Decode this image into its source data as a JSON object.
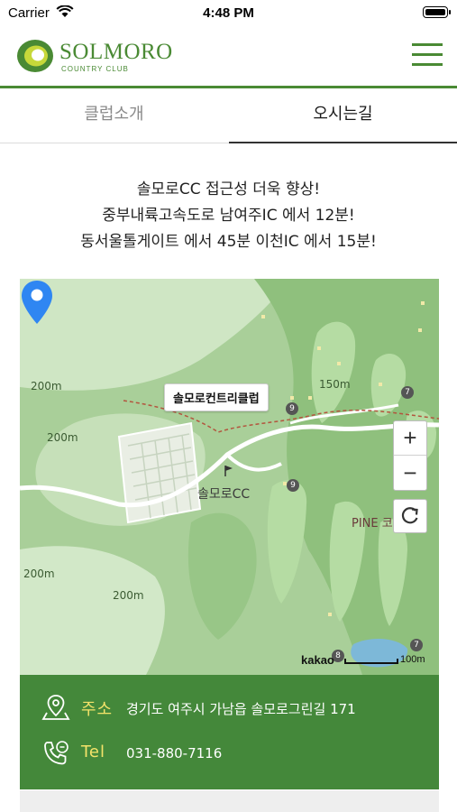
{
  "status_bar": {
    "carrier": "Carrier",
    "time": "4:48 PM"
  },
  "header": {
    "logo_name": "SOLMORO",
    "logo_sub": "COUNTRY CLUB",
    "brand_color": "#4a8a34",
    "menu_icon": "hamburger-menu-icon"
  },
  "tabs": [
    {
      "label": "클럽소개",
      "active": false
    },
    {
      "label": "오시는길",
      "active": true
    }
  ],
  "intro": {
    "line1": "솔모로CC 접근성 더욱 향상!",
    "line2": "중부내륙고속도로 남여주IC 에서 12분!",
    "line3": "동서울톨게이트 에서 45분 이천IC 에서 15분!"
  },
  "map": {
    "marker_title": "솔모로컨트리클럽",
    "place_label": "솔모로CC",
    "contour_labels": [
      "200m",
      "200m",
      "150m",
      "200m",
      "200m"
    ],
    "course_label": "PINE 코",
    "hole_numbers": [
      "9",
      "7",
      "9",
      "8",
      "7"
    ],
    "zoom_in": "+",
    "zoom_out": "−",
    "provider": "kakao",
    "scale": "100m"
  },
  "info": {
    "address_key": "주소",
    "address_value": "경기도 여주시 가남읍 솔모로그린길 171",
    "tel_key": "Tel",
    "tel_value": "031-880-7116",
    "accent_color": "#f4e36a",
    "panel_color": "#44883a"
  }
}
